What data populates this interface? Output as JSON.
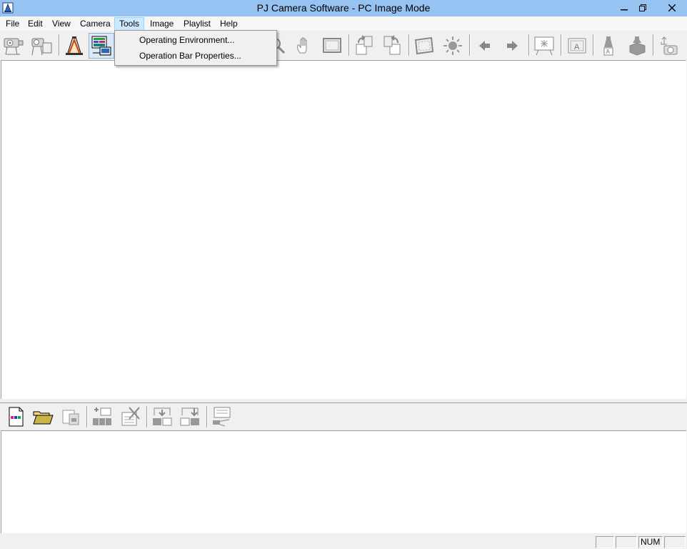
{
  "window": {
    "title": "PJ Camera Software - PC Image Mode",
    "app_icon": "projector-camera-app-icon",
    "controls": {
      "minimize": "minimize-icon",
      "restore": "restore-icon",
      "close": "close-icon"
    }
  },
  "menubar": {
    "items": [
      {
        "label": "File"
      },
      {
        "label": "Edit"
      },
      {
        "label": "View"
      },
      {
        "label": "Camera"
      },
      {
        "label": "Tools",
        "open": true
      },
      {
        "label": "Image"
      },
      {
        "label": "Playlist"
      },
      {
        "label": "Help"
      }
    ]
  },
  "tools_menu": {
    "items": [
      {
        "label": "Operating Environment..."
      },
      {
        "label": "Operation Bar Properties..."
      }
    ]
  },
  "toolbar": {
    "icons": [
      "camera-projector-icon",
      "camera-screen-icon",
      "document-camera-icon",
      "pc-image-mode-icon",
      "zoom-icon",
      "hand-pan-icon",
      "frame-icon",
      "rotate-right-icon",
      "rotate-left-icon",
      "crop-icon",
      "brightness-icon",
      "arrow-left-icon",
      "arrow-right-icon",
      "presenter-icon",
      "image-text-icon",
      "highlight-up-icon",
      "highlight-down-icon",
      "camera-usb-icon"
    ]
  },
  "playlist_toolbar": {
    "icons": [
      "new-playlist-icon",
      "open-folder-icon",
      "save-playlist-icon",
      "add-image-icon",
      "delete-image-icon",
      "move-up-icon",
      "move-down-icon",
      "play-slideshow-icon"
    ]
  },
  "statusbar": {
    "panes": [
      "",
      "",
      "NUM",
      ""
    ]
  },
  "colors": {
    "titlebar": "#97c3f3",
    "menu_highlight": "#cde8ff",
    "workspace": "#ffffff",
    "chrome": "#f0f0f0"
  }
}
